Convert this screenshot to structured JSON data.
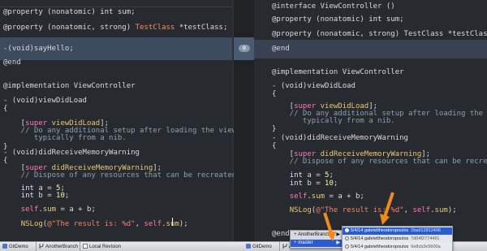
{
  "left_editor": {
    "lines": [
      {
        "parts": [
          {
            "c": "",
            "t": "@property (nonatomic) "
          },
          {
            "c": "type",
            "t": "int"
          },
          {
            "c": "",
            "t": " sum;"
          }
        ]
      },
      {
        "parts": [
          {
            "c": "",
            "t": "@property (nonatomic, strong) "
          },
          {
            "c": "tc",
            "t": "TestClass"
          },
          {
            "c": "",
            "t": " *testClass;"
          }
        ]
      },
      {
        "parts": [
          {
            "c": "",
            "t": "-(void)sayHello;"
          }
        ]
      },
      {
        "parts": [
          {
            "c": "",
            "t": "@end"
          }
        ]
      },
      {
        "parts": [
          {
            "c": "",
            "t": "@implementation ViewController"
          }
        ]
      },
      {
        "parts": [
          {
            "c": "",
            "t": "- (void)viewDidLoad"
          }
        ]
      },
      {
        "parts": [
          {
            "c": "",
            "t": "{"
          }
        ]
      },
      {
        "parts": [
          {
            "c": "",
            "t": "    ["
          },
          {
            "c": "kw",
            "t": "super"
          },
          {
            "c": "",
            "t": " "
          },
          {
            "c": "fn",
            "t": "viewDidLoad"
          },
          {
            "c": "",
            "t": "];"
          }
        ]
      },
      {
        "parts": [
          {
            "c": "cm",
            "t": "    // Do any additional setup after loading the view,"
          }
        ]
      },
      {
        "parts": [
          {
            "c": "cm",
            "t": "       typically from a nib."
          }
        ]
      },
      {
        "parts": [
          {
            "c": "",
            "t": "}"
          }
        ]
      },
      {
        "parts": [
          {
            "c": "",
            "t": "- (void)didReceiveMemoryWarning"
          }
        ]
      },
      {
        "parts": [
          {
            "c": "",
            "t": "{"
          }
        ]
      },
      {
        "parts": [
          {
            "c": "",
            "t": "    ["
          },
          {
            "c": "kw",
            "t": "super"
          },
          {
            "c": "",
            "t": " "
          },
          {
            "c": "fn",
            "t": "didReceiveMemoryWarning"
          },
          {
            "c": "",
            "t": "];"
          }
        ]
      },
      {
        "parts": [
          {
            "c": "cm",
            "t": "    // Dispose of any resources that can be recreated."
          }
        ]
      },
      {
        "parts": [
          {
            "c": "",
            "t": "    "
          },
          {
            "c": "type",
            "t": "int"
          },
          {
            "c": "",
            "t": " a = "
          },
          {
            "c": "num",
            "t": "5"
          },
          {
            "c": "",
            "t": ";"
          }
        ]
      },
      {
        "parts": [
          {
            "c": "",
            "t": "    "
          },
          {
            "c": "type",
            "t": "int"
          },
          {
            "c": "",
            "t": " b = "
          },
          {
            "c": "num",
            "t": "10"
          },
          {
            "c": "",
            "t": ";"
          }
        ]
      },
      {
        "parts": [
          {
            "c": "",
            "t": "    "
          },
          {
            "c": "kw",
            "t": "self"
          },
          {
            "c": "",
            "t": "."
          },
          {
            "c": "fn",
            "t": "sum"
          },
          {
            "c": "",
            "t": " = a + b;"
          }
        ]
      },
      {
        "parts": [
          {
            "c": "",
            "t": "    "
          },
          {
            "c": "fn",
            "t": "NSLog"
          },
          {
            "c": "",
            "t": "("
          },
          {
            "c": "str",
            "t": "@\"The result is: %d\""
          },
          {
            "c": "",
            "t": ", "
          },
          {
            "c": "kw",
            "t": "self"
          },
          {
            "c": "",
            "t": "."
          },
          {
            "c": "fn",
            "t": "sum"
          },
          {
            "c": "",
            "t": ");"
          }
        ]
      }
    ]
  },
  "right_editor": {
    "lines": [
      {
        "parts": [
          {
            "c": "",
            "t": "@interface ViewController ()"
          }
        ]
      },
      {
        "parts": [
          {
            "c": "",
            "t": "@property (nonatomic) "
          },
          {
            "c": "type",
            "t": "int"
          },
          {
            "c": "",
            "t": " sum;"
          }
        ]
      },
      {
        "parts": [
          {
            "c": "",
            "t": "@property (nonatomic, strong) TestClass *testClass;"
          }
        ]
      },
      {
        "parts": [
          {
            "c": "",
            "t": "@end"
          }
        ]
      },
      {
        "parts": [
          {
            "c": "",
            "t": "@implementation ViewController"
          }
        ]
      },
      {
        "parts": [
          {
            "c": "",
            "t": "- (void)viewDidLoad"
          }
        ]
      },
      {
        "parts": [
          {
            "c": "",
            "t": "{"
          }
        ]
      },
      {
        "parts": [
          {
            "c": "",
            "t": "    ["
          },
          {
            "c": "kw",
            "t": "super"
          },
          {
            "c": "",
            "t": " "
          },
          {
            "c": "fn",
            "t": "viewDidLoad"
          },
          {
            "c": "",
            "t": "];"
          }
        ]
      },
      {
        "parts": [
          {
            "c": "cm",
            "t": "    // Do any additional setup after loading the view,"
          }
        ]
      },
      {
        "parts": [
          {
            "c": "cm",
            "t": "       typically from a nib."
          }
        ]
      },
      {
        "parts": [
          {
            "c": "",
            "t": "}"
          }
        ]
      },
      {
        "parts": [
          {
            "c": "",
            "t": "- (void)didReceiveMemoryWarning"
          }
        ]
      },
      {
        "parts": [
          {
            "c": "",
            "t": "{"
          }
        ]
      },
      {
        "parts": [
          {
            "c": "",
            "t": "    ["
          },
          {
            "c": "kw",
            "t": "super"
          },
          {
            "c": "",
            "t": " "
          },
          {
            "c": "fn",
            "t": "didReceiveMemoryWarning"
          },
          {
            "c": "",
            "t": "];"
          }
        ]
      },
      {
        "parts": [
          {
            "c": "cm",
            "t": "    // Dispose of any resources that can be recreated."
          }
        ]
      },
      {
        "parts": [
          {
            "c": "",
            "t": "    "
          },
          {
            "c": "type",
            "t": "int"
          },
          {
            "c": "",
            "t": " a = "
          },
          {
            "c": "num",
            "t": "5"
          },
          {
            "c": "",
            "t": ";"
          }
        ]
      },
      {
        "parts": [
          {
            "c": "",
            "t": "    "
          },
          {
            "c": "type",
            "t": "int"
          },
          {
            "c": "",
            "t": " b = "
          },
          {
            "c": "num",
            "t": "10"
          },
          {
            "c": "",
            "t": ";"
          }
        ]
      },
      {
        "parts": [
          {
            "c": "",
            "t": "    "
          },
          {
            "c": "kw",
            "t": "self"
          },
          {
            "c": "",
            "t": "."
          },
          {
            "c": "fn",
            "t": "sum"
          },
          {
            "c": "",
            "t": " = a + b;"
          }
        ]
      },
      {
        "parts": [
          {
            "c": "",
            "t": "    "
          },
          {
            "c": "fn",
            "t": "NSLog"
          },
          {
            "c": "",
            "t": "("
          },
          {
            "c": "str",
            "t": "@\"The result is: %d\""
          },
          {
            "c": "",
            "t": ", "
          },
          {
            "c": "kw",
            "t": "self"
          },
          {
            "c": "",
            "t": "."
          },
          {
            "c": "fn",
            "t": "sum"
          },
          {
            "c": "",
            "t": ");"
          }
        ]
      },
      {
        "parts": [
          {
            "c": "",
            "t": "@end"
          }
        ]
      }
    ]
  },
  "diff": {
    "change_badge": "0"
  },
  "status_left": {
    "project": "GitDemo",
    "branch": "AnotherBranch",
    "revision": "Local Revision"
  },
  "status_right": {
    "project": "GitDemo",
    "branch": "AnotherBranch"
  },
  "branch_menu": {
    "items": [
      {
        "label": "AnotherBranch"
      },
      {
        "label": "master"
      }
    ]
  },
  "commit_menu": {
    "items": [
      {
        "date": "5/4/14",
        "author": "gabrieltheodoropoulos",
        "hash": "2ba912812406"
      },
      {
        "date": "5/4/14",
        "author": "gabrieltheodoropoulos",
        "hash": "7d04f2774491"
      },
      {
        "date": "5/4/14",
        "author": "gabrieltheodoropoulos",
        "hash": "6e8cb3e5600a"
      }
    ]
  },
  "colors": {
    "editor_bg": "#272a2e",
    "keyword": "#ff7ab8",
    "comment": "#8ea0b2",
    "number": "#f9f7a6",
    "string": "#f48272",
    "selection": "#2b5bd2",
    "annotation_arrow": "#f08a1c"
  },
  "icons": [
    "branch-icon",
    "project-icon",
    "commit-radio-icon",
    "submenu-arrow-icon",
    "annotation-arrow"
  ]
}
